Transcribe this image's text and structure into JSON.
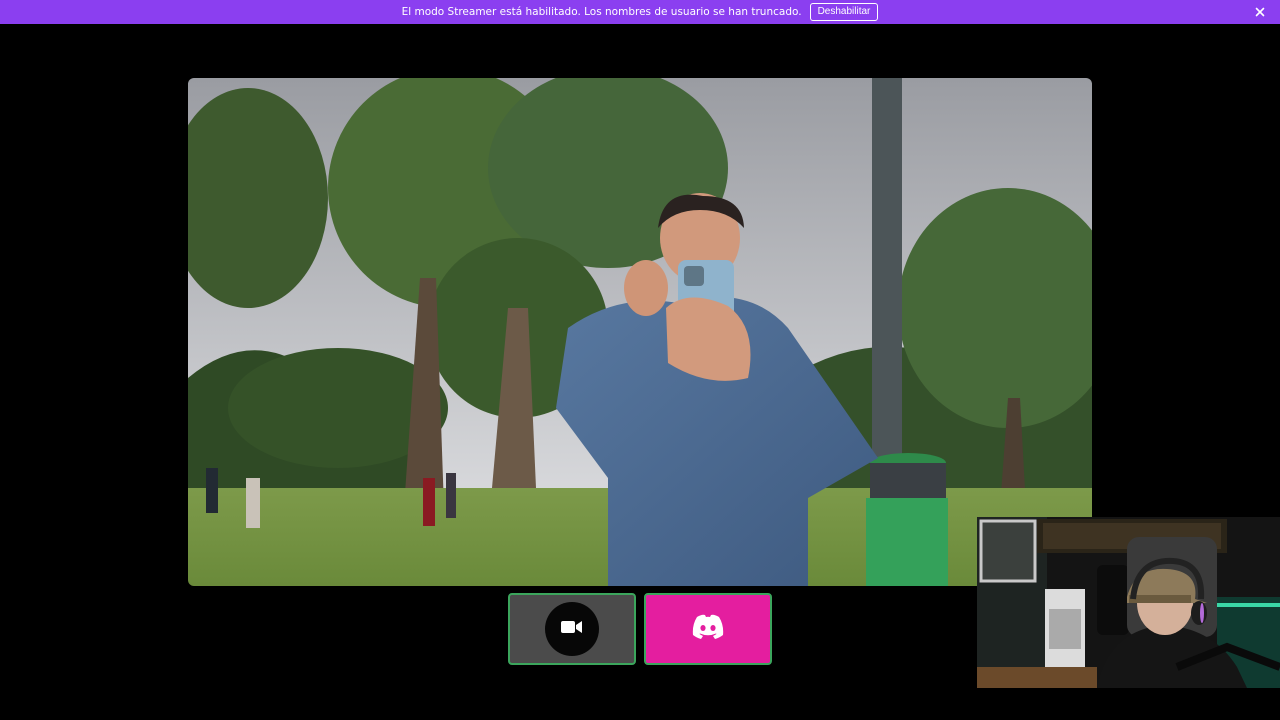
{
  "notice": {
    "message": "El modo Streamer está habilitado. Los nombres de usuario se han truncado.",
    "button_label": "Deshabilitar"
  },
  "icons": {
    "close": "close-icon",
    "camera": "video-camera-icon",
    "discord": "discord-logo-icon"
  },
  "colors": {
    "notice_bg": "#8b3ff0",
    "discord_tile": "#e41e9f",
    "speaking_border": "#3ba55c",
    "camera_tile": "#4b4b4b"
  }
}
